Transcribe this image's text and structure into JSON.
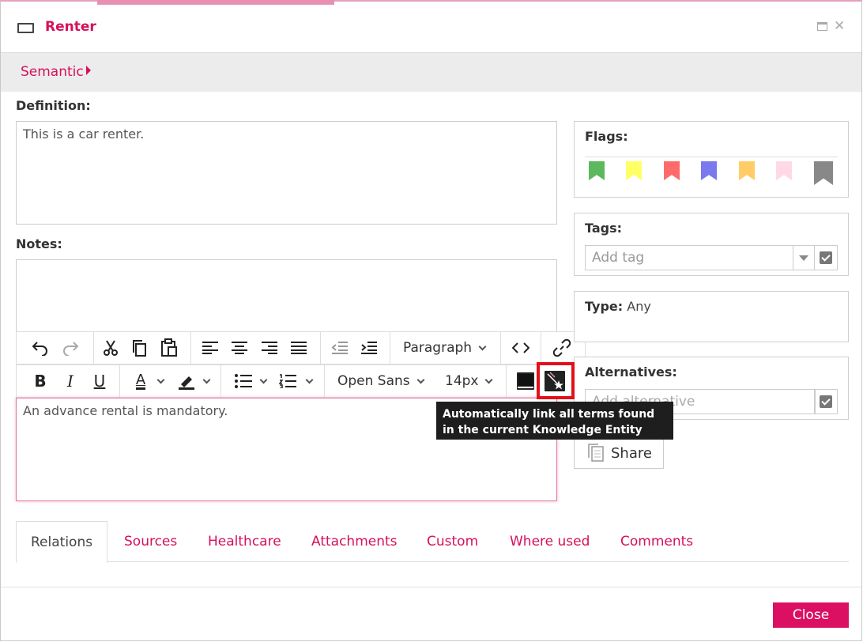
{
  "window": {
    "title": "Renter"
  },
  "breadcrumb": {
    "label": "Semantic"
  },
  "definition": {
    "label": "Definition:",
    "value": "This is a car renter."
  },
  "notes": {
    "label": "Notes:",
    "value": "An advance rental is mandatory.",
    "toolbar": {
      "block_format": "Paragraph",
      "font_family": "Open Sans",
      "font_size": "14px"
    },
    "tooltip": "Automatically link all terms found in the current Knowledge Entity model"
  },
  "flags": {
    "label": "Flags:",
    "colors": [
      "#5cb85c",
      "#ffff66",
      "#ff6b6b",
      "#7a7aee",
      "#ffcc66",
      "#ffd9e6",
      "#888888"
    ]
  },
  "tags": {
    "label": "Tags:",
    "placeholder": "Add tag"
  },
  "type": {
    "label": "Type:",
    "value": "Any"
  },
  "alternatives": {
    "label": "Alternatives:",
    "placeholder": "Add alternative"
  },
  "share": {
    "label": "Share"
  },
  "tabs": [
    {
      "label": "Relations",
      "active": true
    },
    {
      "label": "Sources"
    },
    {
      "label": "Healthcare"
    },
    {
      "label": "Attachments"
    },
    {
      "label": "Custom"
    },
    {
      "label": "Where used"
    },
    {
      "label": "Comments"
    }
  ],
  "footer": {
    "close_label": "Close"
  },
  "colors": {
    "accent": "#d6105a",
    "button": "#db1063",
    "highlight": "#e3101b"
  }
}
